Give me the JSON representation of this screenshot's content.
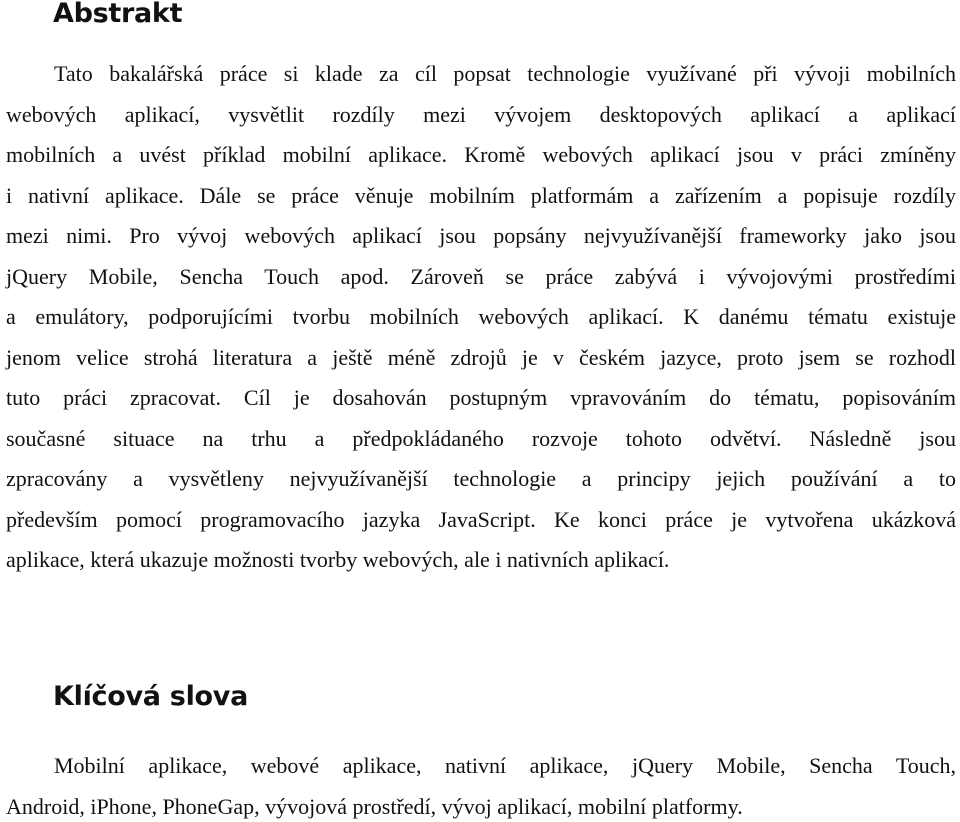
{
  "document": {
    "sections": [
      {
        "heading": "Abstrakt",
        "lines": [
          "Tato bakalářská práce si klade za cíl popsat technologie využívané při vývoji mobilních",
          "webových aplikací, vysvětlit rozdíly mezi vývojem desktopových aplikací a aplikací",
          "mobilních a uvést příklad mobilní aplikace. Kromě webových aplikací jsou v práci zmíněny",
          "i nativní aplikace. Dále se práce věnuje mobilním platformám a zařízením a popisuje rozdíly",
          "mezi nimi. Pro vývoj webových aplikací jsou popsány nejvyužívanější frameworky jako jsou",
          "jQuery Mobile, Sencha Touch apod. Zároveň se práce zabývá i vývojovými prostředími",
          "a emulátory, podporujícími tvorbu mobilních webových aplikací. K danému tématu existuje",
          "jenom velice strohá literatura a ještě méně zdrojů je v českém jazyce, proto jsem se rozhodl",
          "tuto práci zpracovat. Cíl je dosahován postupným vpravováním do tématu, popisováním",
          "současné situace na trhu a předpokládaného rozvoje tohoto odvětví. Následně jsou",
          "zpracovány a vysvětleny nejvyužívanější technologie a principy jejich používání a to",
          "především pomocí programovacího jazyka JavaScript. Ke konci práce je vytvořena ukázková",
          "aplikace, která ukazuje možnosti tvorby webových, ale i nativních aplikací."
        ]
      },
      {
        "heading": "Klíčová slova",
        "lines": [
          "Mobilní aplikace, webové aplikace, nativní aplikace, jQuery Mobile, Sencha Touch,",
          "Android, iPhone, PhoneGap, vývojová prostředí, vývoj aplikací, mobilní platformy."
        ]
      }
    ]
  }
}
